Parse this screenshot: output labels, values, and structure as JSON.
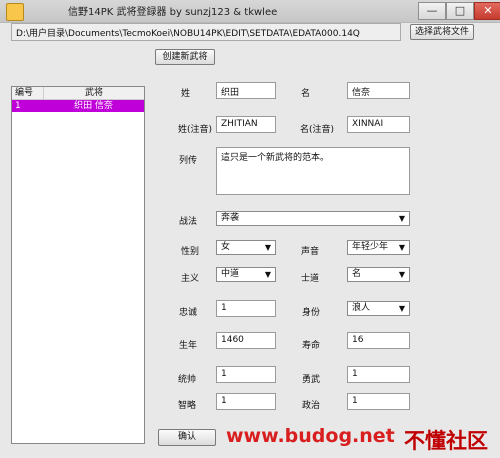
{
  "window": {
    "title": "信野14PK 武将登録器 by sunzj123 & tkwlee",
    "minimize": "—",
    "maximize": "□",
    "close": "✕"
  },
  "path": {
    "value": "D:\\用户目录\\Documents\\TecmoKoei\\NOBU14PK\\EDIT\\SETDATA\\EDATA000.14Q"
  },
  "buttons": {
    "choose_file": "选择武将文件",
    "create": "创建新武将",
    "confirm": "确认"
  },
  "list": {
    "columns": [
      "编号",
      "武将"
    ],
    "rows": [
      {
        "id": "1",
        "name": "织田 信奈",
        "selected": true
      }
    ]
  },
  "form": {
    "labels": {
      "family": "姓",
      "given": "名",
      "family_reading": "姓(注音)",
      "given_reading": "名(注音)",
      "bio": "列传",
      "tactic": "战法",
      "gender": "性别",
      "voice": "声音",
      "ideology": "主义",
      "path": "士道",
      "loyalty": "忠诚",
      "rank": "身份",
      "birth": "生年",
      "lifespan": "寿命",
      "command": "统帅",
      "valor": "勇武",
      "intellect": "智略",
      "politics": "政治"
    },
    "values": {
      "family": "织田",
      "given": "信奈",
      "family_reading": "ZHITIAN",
      "given_reading": "XINNAI",
      "bio": "這只是一个新武将的范本。",
      "tactic": "奔袭",
      "gender": "女",
      "voice": "年轻少年",
      "ideology": "中道",
      "path": "名",
      "loyalty": "1",
      "rank": "浪人",
      "birth": "1460",
      "lifespan": "16",
      "command": "1",
      "valor": "1",
      "intellect": "1",
      "politics": "1"
    }
  },
  "watermark": {
    "site": "www.budog.net",
    "brand": "不懂社区"
  }
}
